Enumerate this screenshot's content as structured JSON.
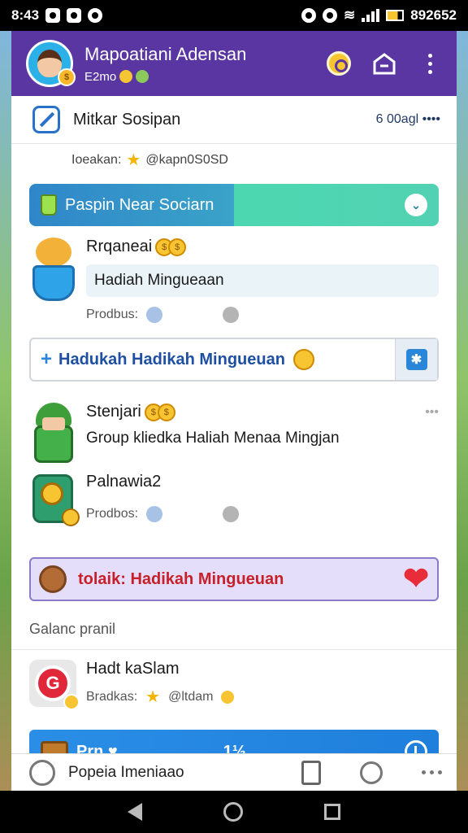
{
  "status_bar": {
    "time": "8:43",
    "battery": "892652"
  },
  "header": {
    "title": "Mapoatiani Adensan",
    "subtitle": "E2mo",
    "avatar_badge": "$"
  },
  "row_top": {
    "title": "Mitkar Sosipan",
    "meta": "6 00agl ••••",
    "sub_text": "Ioeakan:",
    "sub_handle": "@kapn0S0SD"
  },
  "banner_green": {
    "label": "Paspin Near Sociarn"
  },
  "card1": {
    "name": "Rrqaneai",
    "pill": "Hadiah Mingueaan",
    "prod": "Prodbus:"
  },
  "banner_white": {
    "label": "Hadukah Hadikah Mingueuan",
    "button_glyph": "✱"
  },
  "card2": {
    "name": "Stenjari",
    "text": "Group kliedka Haliah Menaa Mingjan",
    "more": "•••"
  },
  "card3": {
    "name": "Palnawia2",
    "prod": "Prodbos:"
  },
  "banner_purple": {
    "label": "tolaik: Hadikah Mingueuan",
    "heart": "❤"
  },
  "section": {
    "title": "Galanc pranil"
  },
  "card4": {
    "name": "Hadt kaSlam",
    "prod": "Bradkas:",
    "handle": "@ltdam",
    "logo_letter": "G"
  },
  "banner_blue": {
    "label": "Prn.",
    "middle": "1½"
  },
  "bottom_nav": {
    "label": "Popeia Imeniaao"
  },
  "colors": {
    "header": "#5a36a2",
    "accent_blue": "#2a8ee6",
    "heart": "#e82c3a"
  }
}
